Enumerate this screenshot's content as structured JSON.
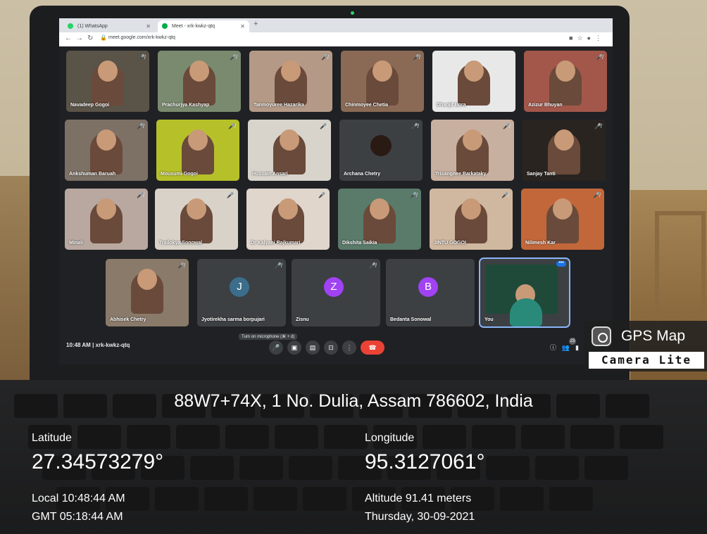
{
  "browser": {
    "tabs": [
      {
        "label": "(1) WhatsApp",
        "favicon_color": "#25d366"
      },
      {
        "label": "Meet - xrk-kwkz-qtq",
        "favicon_color": "#00ac47"
      }
    ],
    "url": "meet.google.com/xrk-kwkz-qtq"
  },
  "participants": [
    {
      "name": "Navadeep Gogoi",
      "bg": "#5a5347"
    },
    {
      "name": "Prachurjya Kashyap",
      "bg": "#7a8a6e"
    },
    {
      "name": "Tanmoyuree Hazarika",
      "bg": "#b49a86"
    },
    {
      "name": "Chinmoyee Chetia",
      "bg": "#8a6a55"
    },
    {
      "name": "Dhanjit Bora",
      "bg": "#e8e8e8"
    },
    {
      "name": "Azizur Bhuyan",
      "bg": "#a3574a"
    },
    {
      "name": "Ankshuman Baruah",
      "bg": "#7d7166"
    },
    {
      "name": "Mousumi Gogoi",
      "bg": "#b6c12a"
    },
    {
      "name": "Hussain Ansari",
      "bg": "#d8d4cc"
    },
    {
      "name": "Archana Chetry",
      "bg": "#3c4043"
    },
    {
      "name": "Trisangnee Barkataky",
      "bg": "#c8b0a0"
    },
    {
      "name": "Sanjay Tanti",
      "bg": "#2a2420"
    },
    {
      "name": "Minali",
      "bg": "#b8a8a0"
    },
    {
      "name": "Trailokya Sonowal",
      "bg": "#d9d2c8"
    },
    {
      "name": "Dr Kalyani Rajkumari",
      "bg": "#e0d6cc"
    },
    {
      "name": "Dikshita Saikia",
      "bg": "#5a7a6a"
    },
    {
      "name": "JINTU GOGOI",
      "bg": "#d0b8a0"
    },
    {
      "name": "Nilimesh Kar",
      "bg": "#c2673a"
    },
    {
      "name": "Abhisek Chetry",
      "bg": "#8a7a6a"
    }
  ],
  "avatars": [
    {
      "initial": "J",
      "name": "Jyotirekha sarma borpujari",
      "color": "#3c6e8c"
    },
    {
      "initial": "Z",
      "name": "Zisnu",
      "color": "#a142f4"
    },
    {
      "initial": "B",
      "name": "Bedanta Sonowal",
      "color": "#a142f4"
    }
  ],
  "self_tile": {
    "name": "You"
  },
  "bottombar": {
    "time": "10:48 AM",
    "separator": "|",
    "code": "xrk-kwkz-qtq",
    "tooltip": "Turn on microphone (⌘ + d)",
    "participant_count": "23"
  },
  "gps": {
    "app_title": "GPS Map",
    "app_sub": "Camera Lite",
    "address": "88W7+74X, 1 No. Dulia, Assam 786602, India",
    "latitude_label": "Latitude",
    "latitude": "27.34573279°",
    "longitude_label": "Longitude",
    "longitude": "95.3127061°",
    "local_time": "Local 10:48:44 AM",
    "gmt_time": "GMT 05:18:44 AM",
    "altitude": "Altitude 91.41 meters",
    "date": "Thursday, 30-09-2021"
  }
}
